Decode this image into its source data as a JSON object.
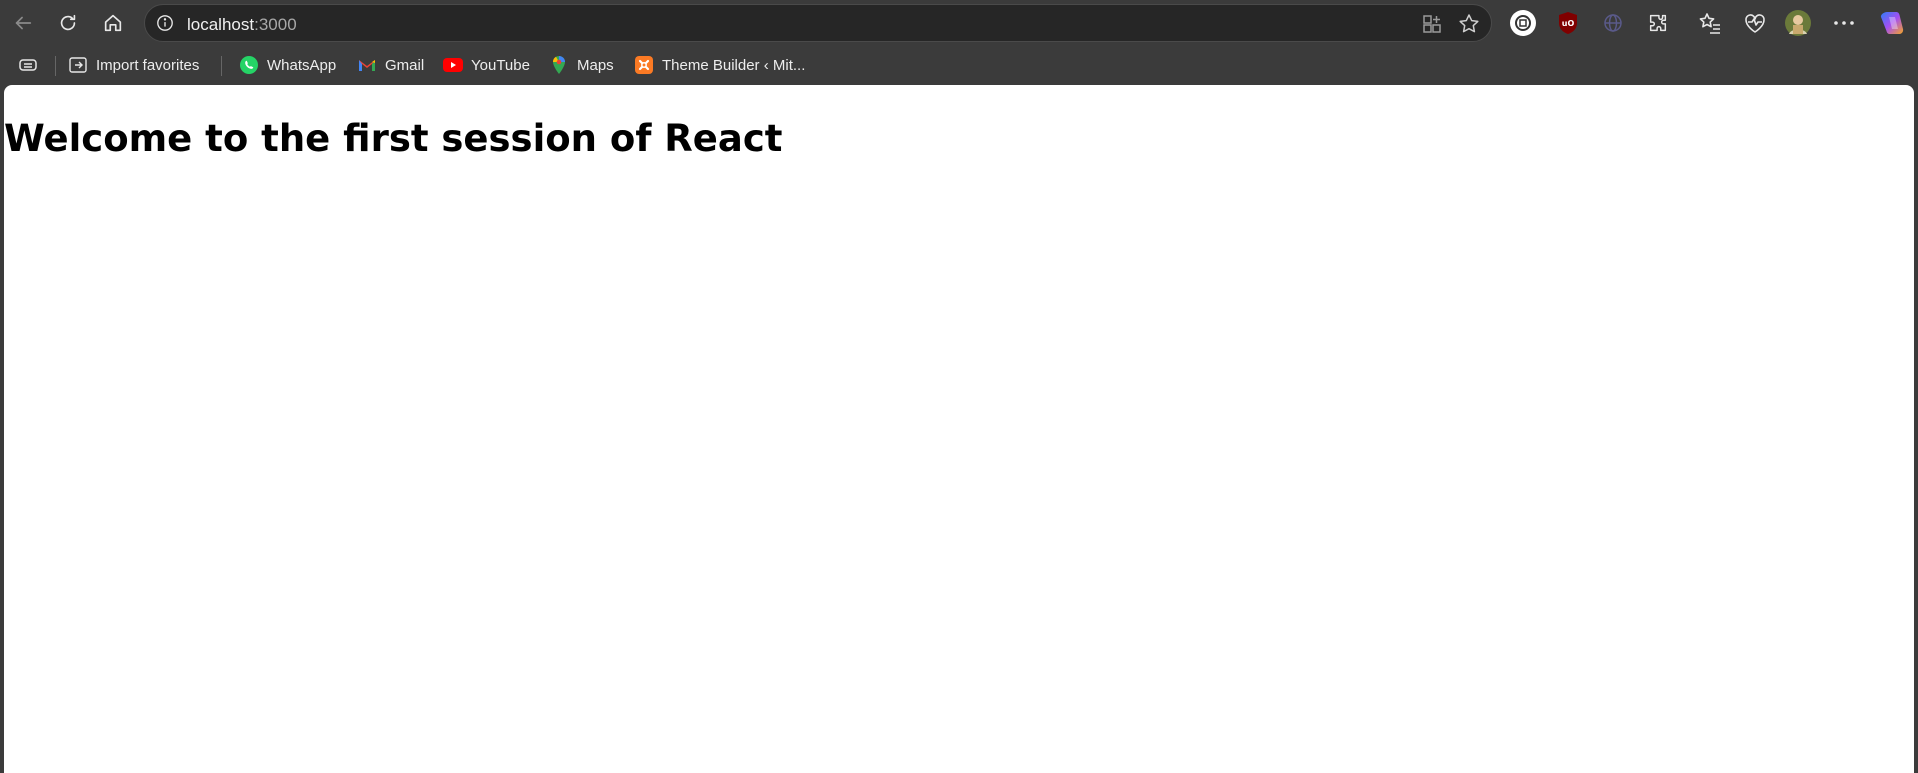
{
  "browser": {
    "address_bar": {
      "host": "localhost",
      "port": ":3000"
    },
    "bookmarks": [
      {
        "label": "Import favorites",
        "icon": "import-favorites-icon"
      },
      {
        "label": "WhatsApp",
        "icon": "whatsapp-icon"
      },
      {
        "label": "Gmail",
        "icon": "gmail-icon"
      },
      {
        "label": "YouTube",
        "icon": "youtube-icon"
      },
      {
        "label": "Maps",
        "icon": "maps-icon"
      },
      {
        "label": "Theme Builder ‹ Mit...",
        "icon": "theme-builder-icon"
      }
    ],
    "extensions": {
      "ublock_badge": "uO"
    },
    "colors": {
      "chrome_bg": "#3b3b3b",
      "address_bg": "#262626",
      "page_bg": "#ffffff"
    }
  },
  "page": {
    "heading": "Welcome to the first session of React"
  }
}
